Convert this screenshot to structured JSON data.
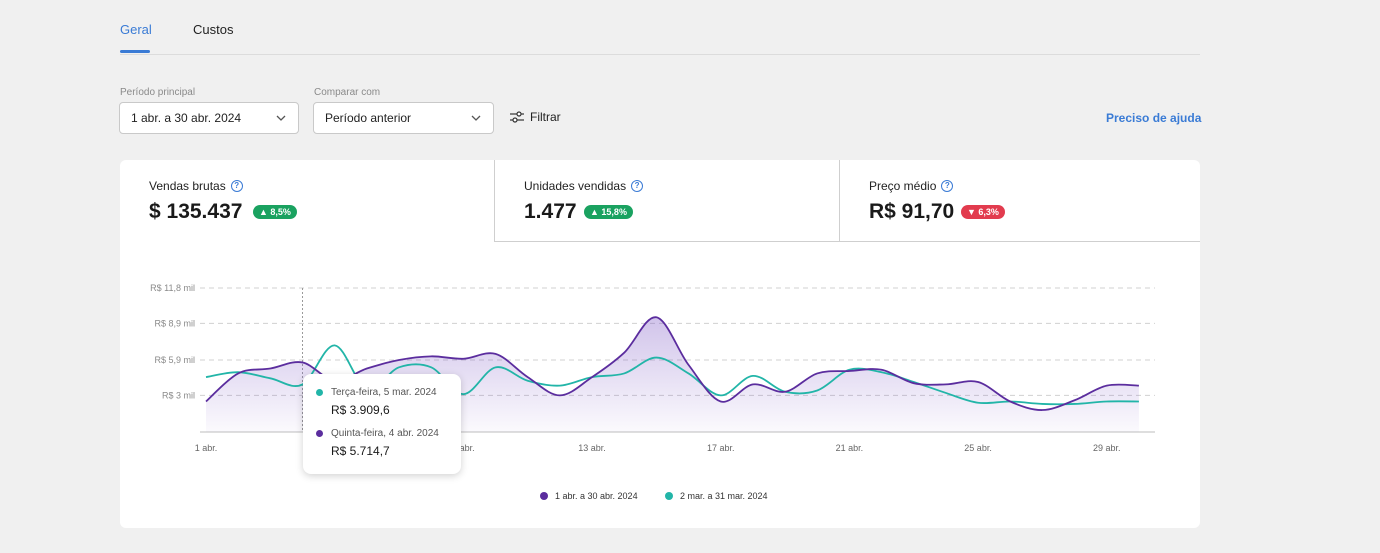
{
  "tabs": [
    {
      "label": "Geral",
      "active": true
    },
    {
      "label": "Custos",
      "active": false
    }
  ],
  "filters": {
    "main_period_label": "Período principal",
    "main_period_value": "1 abr. a 30 abr. 2024",
    "compare_label": "Comparar com",
    "compare_value": "Período anterior",
    "filter_label": "Filtrar",
    "help_label": "Preciso de ajuda"
  },
  "metrics": [
    {
      "label": "Vendas brutas",
      "value": "$ 135.437",
      "change": "8,5%",
      "direction": "up"
    },
    {
      "label": "Unidades vendidas",
      "value": "1.477",
      "change": "15,8%",
      "direction": "up"
    },
    {
      "label": "Preço médio",
      "value": "R$ 91,70",
      "change": "6,3%",
      "direction": "down"
    }
  ],
  "colors": {
    "primary": "#5b2d9e",
    "secondary": "#22b5a8",
    "accent": "#3a7bd5",
    "up": "#1aa260",
    "down": "#e23b4e"
  },
  "chart_data": {
    "type": "line",
    "y_ticks": [
      "R$ 11,8 mil",
      "R$ 8,9 mil",
      "R$ 5,9 mil",
      "R$ 3 mil"
    ],
    "y_tick_values": [
      11.8,
      8.9,
      5.9,
      3.0
    ],
    "ylim": [
      0,
      11.8
    ],
    "x_ticks": [
      "1 abr.",
      "5 abr.",
      "9 abr.",
      "13 abr.",
      "17 abr.",
      "21 abr.",
      "25 abr.",
      "29 abr."
    ],
    "x_tick_days": [
      1,
      5,
      9,
      13,
      17,
      21,
      25,
      29
    ],
    "grid": true,
    "legend_position": "bottom",
    "series": [
      {
        "name": "1 abr. a 30 abr. 2024",
        "color": "#5b2d9e",
        "filled": true,
        "x": [
          1,
          2,
          3,
          4,
          5,
          6,
          7,
          8,
          9,
          10,
          11,
          12,
          13,
          14,
          15,
          16,
          17,
          18,
          19,
          20,
          21,
          22,
          23,
          24,
          25,
          26,
          27,
          28,
          29,
          30
        ],
        "values": [
          2.5,
          4.8,
          5.2,
          5.7,
          4.2,
          5.2,
          5.9,
          6.2,
          6.0,
          6.4,
          4.5,
          3.0,
          4.5,
          6.5,
          9.4,
          5.5,
          2.5,
          3.9,
          3.3,
          4.8,
          5.0,
          5.1,
          4.0,
          3.9,
          4.1,
          2.5,
          1.8,
          2.6,
          3.8,
          3.8
        ]
      },
      {
        "name": "2 mar. a 31 mar. 2024",
        "color": "#22b5a8",
        "filled": false,
        "x": [
          1,
          2,
          3,
          4,
          5,
          6,
          7,
          8,
          9,
          10,
          11,
          12,
          13,
          14,
          15,
          16,
          17,
          18,
          19,
          20,
          21,
          22,
          23,
          24,
          25,
          26,
          27,
          28,
          29,
          30
        ],
        "values": [
          4.5,
          4.9,
          4.4,
          3.9,
          7.1,
          3.5,
          5.3,
          5.3,
          3.1,
          5.3,
          4.2,
          3.8,
          4.5,
          4.8,
          6.1,
          4.8,
          3.0,
          4.6,
          3.3,
          3.4,
          5.1,
          4.9,
          4.1,
          3.2,
          2.4,
          2.5,
          2.3,
          2.3,
          2.5,
          2.5
        ]
      }
    ],
    "tooltip": {
      "series2_label": "Terça-feira, 5 mar. 2024",
      "series2_value": "R$ 3.909,6",
      "series1_label": "Quinta-feira, 4 abr. 2024",
      "series1_value": "R$ 5.714,7",
      "hover_x": 4
    }
  }
}
